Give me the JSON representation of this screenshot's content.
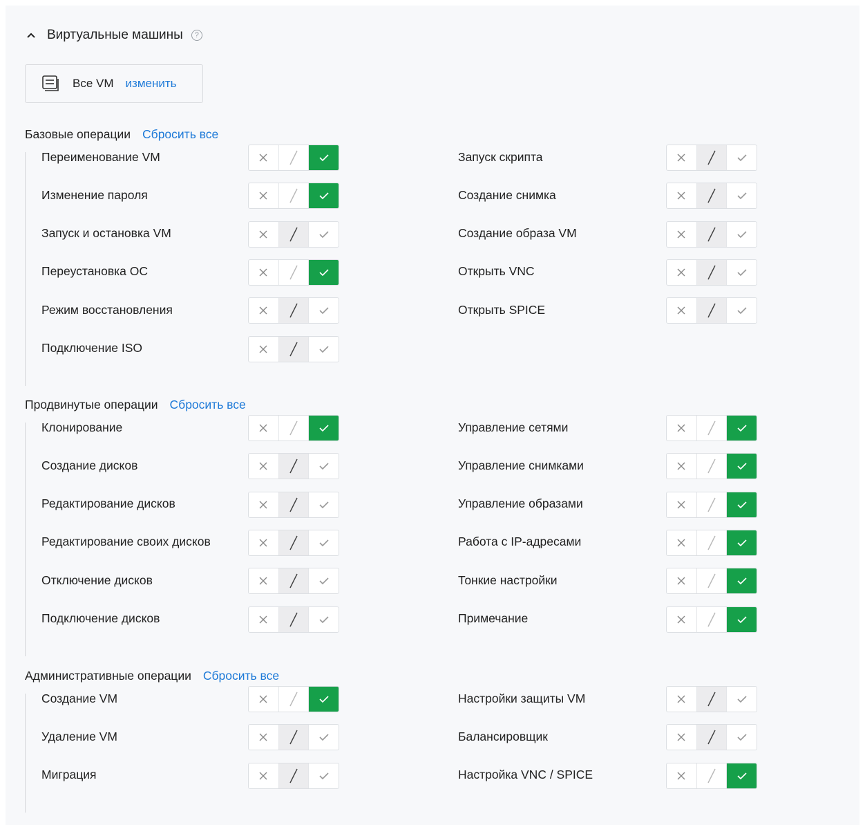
{
  "section": {
    "title": "Виртуальные машины",
    "help_glyph": "?",
    "vm_selector": {
      "label": "Все VM",
      "change_link": "изменить"
    }
  },
  "colors": {
    "allow_active": "#16a04a",
    "link": "#1e7ad8"
  },
  "groups": [
    {
      "title": "Базовые операции",
      "reset": "Сбросить все",
      "left": [
        {
          "label": "Переименование VM",
          "state": "allow"
        },
        {
          "label": "Изменение пароля",
          "state": "allow"
        },
        {
          "label": "Запуск и остановка VM",
          "state": "partial"
        },
        {
          "label": "Переустановка ОС",
          "state": "allow"
        },
        {
          "label": "Режим восстановления",
          "state": "partial"
        },
        {
          "label": "Подключение ISO",
          "state": "partial"
        }
      ],
      "right": [
        {
          "label": "Запуск скрипта",
          "state": "partial"
        },
        {
          "label": "Создание снимка",
          "state": "partial"
        },
        {
          "label": "Создание образа VM",
          "state": "partial"
        },
        {
          "label": "Открыть VNC",
          "state": "partial"
        },
        {
          "label": "Открыть SPICE",
          "state": "partial"
        }
      ]
    },
    {
      "title": "Продвинутые операции",
      "reset": "Сбросить все",
      "left": [
        {
          "label": "Клонирование",
          "state": "allow"
        },
        {
          "label": "Создание дисков",
          "state": "partial"
        },
        {
          "label": "Редактирование дисков",
          "state": "partial"
        },
        {
          "label": "Редактирование своих дисков",
          "state": "partial"
        },
        {
          "label": "Отключение дисков",
          "state": "partial"
        },
        {
          "label": "Подключение дисков",
          "state": "partial"
        }
      ],
      "right": [
        {
          "label": "Управление сетями",
          "state": "allow"
        },
        {
          "label": "Управление снимками",
          "state": "allow"
        },
        {
          "label": "Управление образами",
          "state": "allow"
        },
        {
          "label": "Работа с IP-адресами",
          "state": "allow"
        },
        {
          "label": "Тонкие настройки",
          "state": "allow"
        },
        {
          "label": "Примечание",
          "state": "allow"
        }
      ]
    },
    {
      "title": "Административные операции",
      "reset": "Сбросить все",
      "left": [
        {
          "label": "Создание VM",
          "state": "allow"
        },
        {
          "label": "Удаление VM",
          "state": "partial"
        },
        {
          "label": "Миграция",
          "state": "partial"
        }
      ],
      "right": [
        {
          "label": "Настройки защиты VM",
          "state": "partial"
        },
        {
          "label": "Балансировщик",
          "state": "partial"
        },
        {
          "label": "Настройка VNC / SPICE",
          "state": "allow"
        }
      ]
    }
  ]
}
